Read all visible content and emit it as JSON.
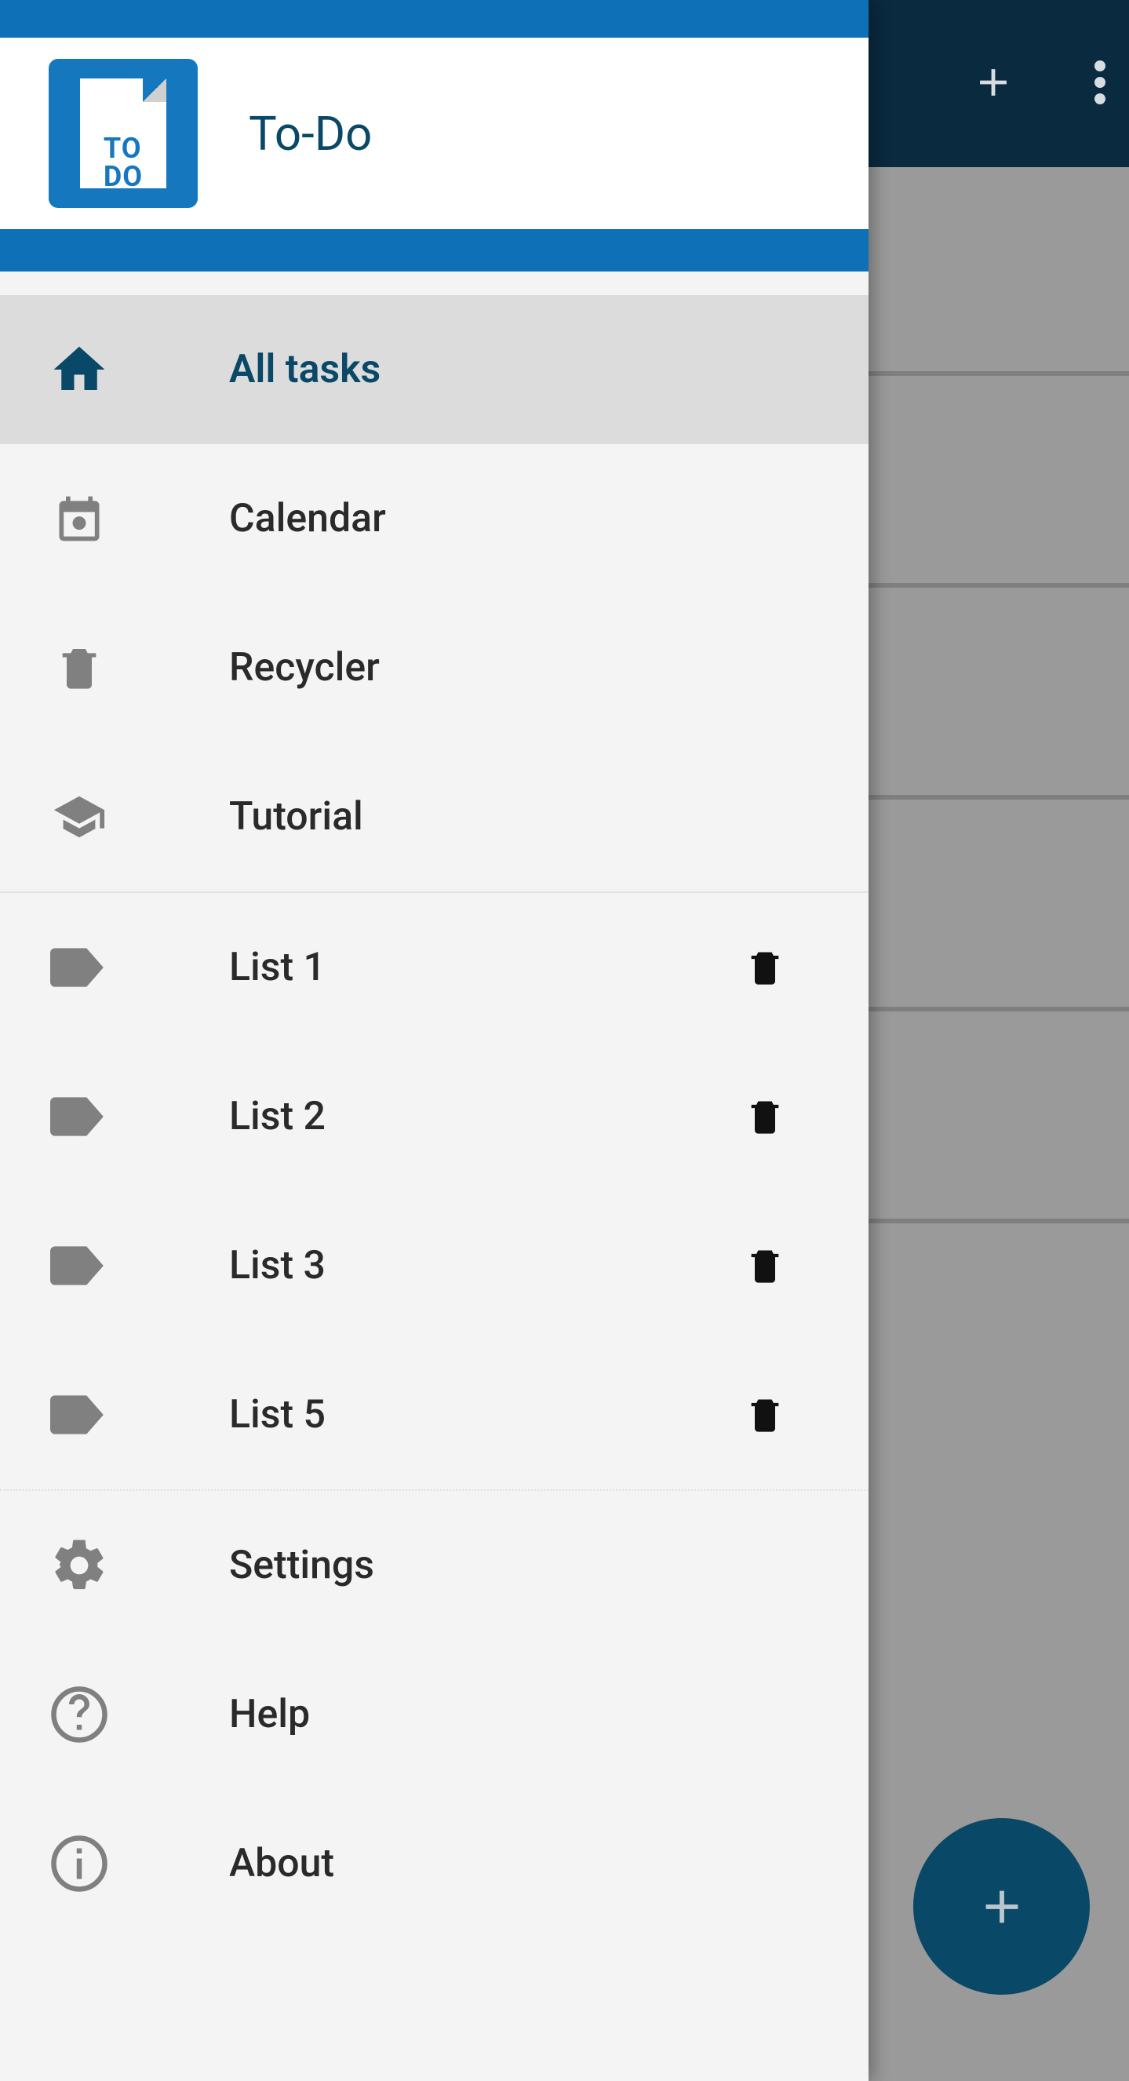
{
  "header": {
    "app_title": "To-Do",
    "logo_text": "TO\nDO"
  },
  "nav": {
    "primary": [
      {
        "label": "All tasks",
        "selected": true,
        "icon": "home"
      },
      {
        "label": "Calendar",
        "selected": false,
        "icon": "calendar"
      },
      {
        "label": "Recycler",
        "selected": false,
        "icon": "trash"
      },
      {
        "label": "Tutorial",
        "selected": false,
        "icon": "school"
      }
    ],
    "lists": [
      {
        "label": "List 1"
      },
      {
        "label": "List 2"
      },
      {
        "label": "List 3"
      },
      {
        "label": "List 5"
      }
    ],
    "footer": [
      {
        "label": "Settings",
        "icon": "gear"
      },
      {
        "label": "Help",
        "icon": "help"
      },
      {
        "label": "About",
        "icon": "info"
      }
    ]
  },
  "background_lines": [
    260,
    530,
    800,
    1070,
    1340
  ]
}
